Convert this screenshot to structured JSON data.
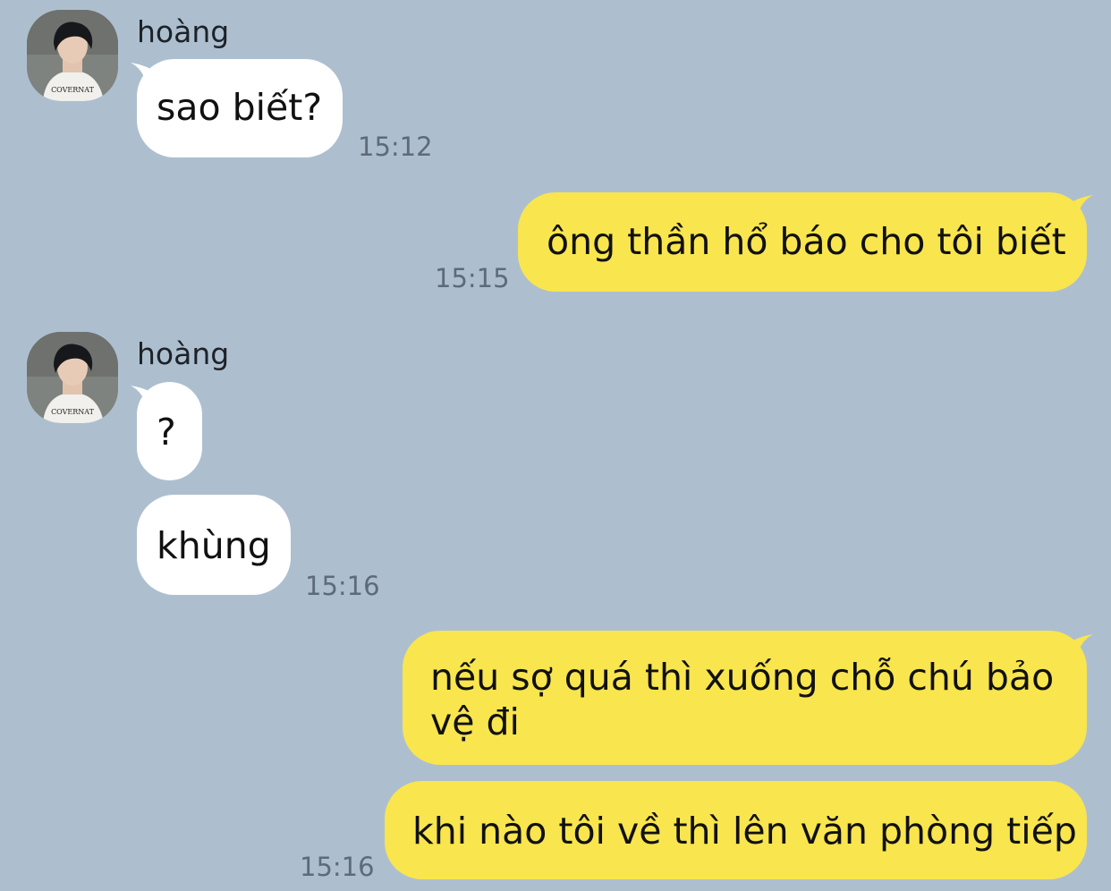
{
  "contact": {
    "name": "hoàng"
  },
  "colors": {
    "background": "#adbfcf",
    "incoming_bubble": "#ffffff",
    "outgoing_bubble": "#f9e54e",
    "timestamp": "#5d6b79"
  },
  "messages": [
    {
      "direction": "incoming",
      "text": "sao biết?",
      "time": "15:12"
    },
    {
      "direction": "outgoing",
      "text": "ông thần hổ báo cho tôi biết",
      "time": "15:15"
    },
    {
      "direction": "incoming",
      "text": "?",
      "time": ""
    },
    {
      "direction": "incoming",
      "text": "khùng",
      "time": "15:16"
    },
    {
      "direction": "outgoing",
      "text_lines": [
        "nếu sợ quá thì xuống chỗ chú bảo",
        "vệ đi"
      ],
      "time": ""
    },
    {
      "direction": "outgoing",
      "text": "khi nào tôi về thì lên văn phòng tiếp",
      "time": "15:16"
    }
  ]
}
